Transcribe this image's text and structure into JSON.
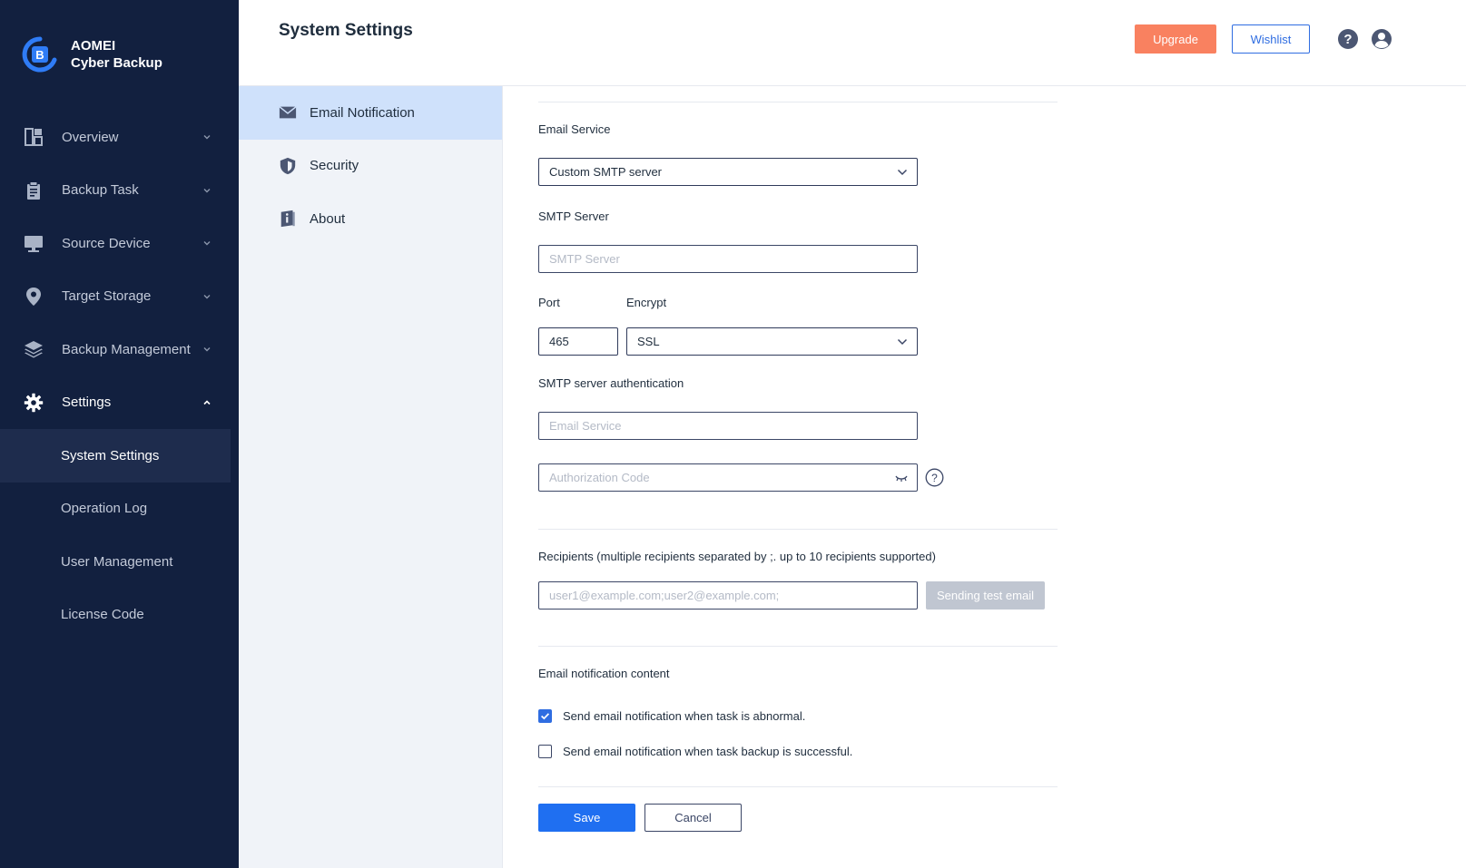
{
  "brand": {
    "name_line1": "AOMEI",
    "name_line2": "Cyber Backup"
  },
  "sidebar": {
    "items": [
      {
        "label": "Overview",
        "icon": "dashboard-icon"
      },
      {
        "label": "Backup Task",
        "icon": "clipboard-icon"
      },
      {
        "label": "Source Device",
        "icon": "monitor-icon"
      },
      {
        "label": "Target Storage",
        "icon": "location-pin-icon"
      },
      {
        "label": "Backup Management",
        "icon": "layers-icon"
      },
      {
        "label": "Settings",
        "icon": "gear-icon"
      }
    ],
    "sub_items": [
      {
        "label": "System Settings"
      },
      {
        "label": "Operation Log"
      },
      {
        "label": "User Management"
      },
      {
        "label": "License Code"
      }
    ]
  },
  "header": {
    "title": "System Settings",
    "upgrade_label": "Upgrade",
    "wishlist_label": "Wishlist"
  },
  "settings_nav": {
    "items": [
      {
        "label": "Email Notification",
        "icon": "envelope-icon"
      },
      {
        "label": "Security",
        "icon": "shield-icon"
      },
      {
        "label": "About",
        "icon": "info-book-icon"
      }
    ]
  },
  "form": {
    "email_service_label": "Email Service",
    "email_service_value": "Custom SMTP server",
    "smtp_server_label": "SMTP Server",
    "smtp_server_placeholder": "SMTP Server",
    "port_label": "Port",
    "port_value": "465",
    "encrypt_label": "Encrypt",
    "encrypt_value": "SSL",
    "auth_label": "SMTP server authentication",
    "auth_email_placeholder": "Email Service",
    "auth_code_placeholder": "Authorization Code",
    "recipients_label": "Recipients (multiple recipients separated by ;. up to 10 recipients supported)",
    "recipients_placeholder": "user1@example.com;user2@example.com;",
    "test_email_label": "Sending test email",
    "content_label": "Email notification content",
    "notify_abnormal_label": "Send email notification when task is abnormal.",
    "notify_abnormal_checked": true,
    "notify_success_label": "Send email notification when task backup is successful.",
    "notify_success_checked": false,
    "save_label": "Save",
    "cancel_label": "Cancel"
  },
  "colors": {
    "sidebar_bg": "#12203f",
    "accent": "#1f6ff1",
    "upgrade": "#f98160",
    "active_tab_bg": "#cfe1fb"
  }
}
